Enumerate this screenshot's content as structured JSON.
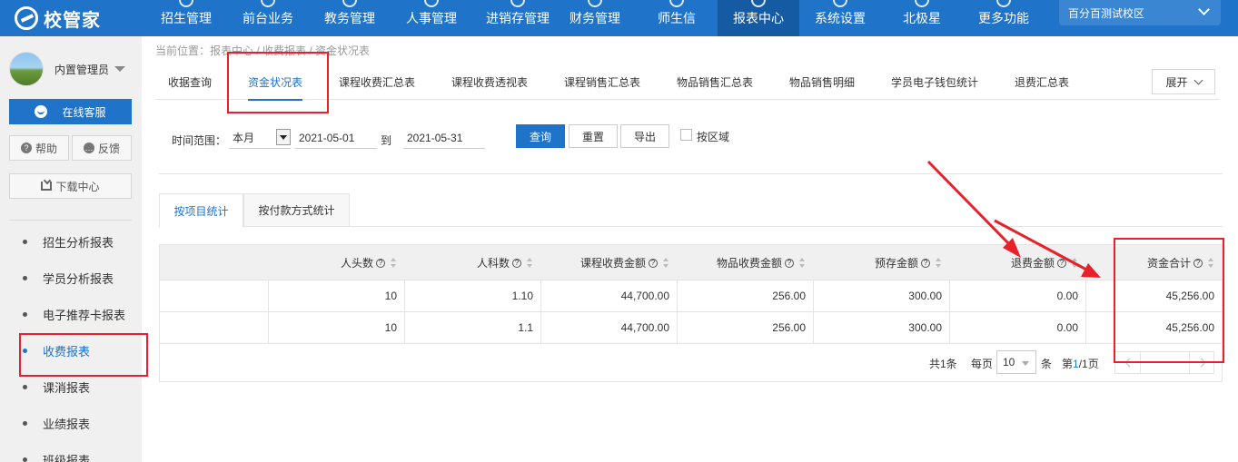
{
  "brand": {
    "name": "校管家"
  },
  "nav": {
    "items": [
      {
        "label": "招生管理"
      },
      {
        "label": "前台业务"
      },
      {
        "label": "教务管理"
      },
      {
        "label": "人事管理"
      },
      {
        "label": "进销存管理"
      },
      {
        "label": "财务管理"
      },
      {
        "label": "师生信"
      },
      {
        "label": "报表中心"
      },
      {
        "label": "系统设置"
      },
      {
        "label": "北极星"
      },
      {
        "label": "更多功能"
      }
    ],
    "campus": "百分百测试校区"
  },
  "sidebar": {
    "user_name": "内置管理员",
    "online_service": "在线客服",
    "help": "帮助",
    "feedback": "反馈",
    "download_center": "下载中心",
    "items": [
      {
        "label": "招生分析报表"
      },
      {
        "label": "学员分析报表"
      },
      {
        "label": "电子推荐卡报表"
      },
      {
        "label": "收费报表"
      },
      {
        "label": "课消报表"
      },
      {
        "label": "业绩报表"
      },
      {
        "label": "班级报表"
      }
    ]
  },
  "breadcrumb": "当前位置：报表中心 / 收费报表 / 资金状况表",
  "tabs": {
    "items": [
      {
        "label": "收据查询"
      },
      {
        "label": "资金状况表"
      },
      {
        "label": "课程收费汇总表"
      },
      {
        "label": "课程收费透视表"
      },
      {
        "label": "课程销售汇总表"
      },
      {
        "label": "物品销售汇总表"
      },
      {
        "label": "物品销售明细"
      },
      {
        "label": "学员电子钱包统计"
      },
      {
        "label": "退费汇总表"
      }
    ],
    "expand": "展开"
  },
  "filter": {
    "time_range_label": "时间范围：",
    "period": "本月",
    "start_date": "2021-05-01",
    "to_label": "到",
    "end_date": "2021-05-31",
    "query": "查询",
    "reset": "重置",
    "export": "导出",
    "by_area": "按区域"
  },
  "subtabs": [
    {
      "label": "按项目统计"
    },
    {
      "label": "按付款方式统计"
    }
  ],
  "table": {
    "headers": [
      "人头数",
      "人科数",
      "课程收费金额",
      "物品收费金额",
      "预存金额",
      "退费金额",
      "资金合计"
    ],
    "rows": [
      [
        "10",
        "1.10",
        "44,700.00",
        "256.00",
        "300.00",
        "0.00",
        "45,256.00"
      ],
      [
        "10",
        "1.1",
        "44,700.00",
        "256.00",
        "300.00",
        "0.00",
        "45,256.00"
      ]
    ],
    "help_glyph": "?"
  },
  "pager": {
    "total": "共1条",
    "per_page_label": "每页",
    "page_size": "10",
    "unit": "条",
    "page_prefix": "第",
    "current": "1",
    "page_suffix": "/1页"
  },
  "colors": {
    "primary": "#1f73c8",
    "annotation": "#e8202a"
  }
}
